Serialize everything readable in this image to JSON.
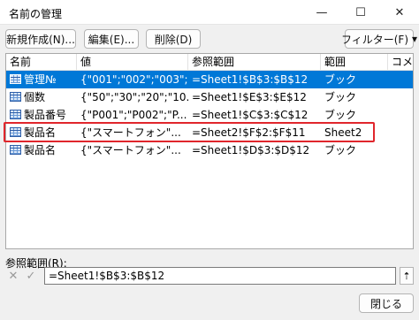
{
  "window": {
    "title": "名前の管理",
    "minimize_glyph": "—",
    "maximize_glyph": "☐",
    "close_glyph": "✕"
  },
  "toolbar": {
    "new_label": "新規作成(N)...",
    "edit_label": "編集(E)...",
    "delete_label": "削除(D)",
    "filter_label": "フィルター(F)",
    "filter_arrow": "▾"
  },
  "columns": [
    "名前",
    "値",
    "参照範囲",
    "範囲",
    "コメ"
  ],
  "rows": [
    {
      "name": "管理№",
      "value": "{\"001\";\"002\";\"003\";...",
      "ref": "=Sheet1!$B$3:$B$12",
      "scope": "ブック",
      "selected": true
    },
    {
      "name": "個数",
      "value": "{\"50\";\"30\";\"20\";\"10...",
      "ref": "=Sheet1!$E$3:$E$12",
      "scope": "ブック",
      "selected": false
    },
    {
      "name": "製品番号",
      "value": "{\"P001\";\"P002\";\"P...",
      "ref": "=Sheet1!$C$3:$C$12",
      "scope": "ブック",
      "selected": false
    },
    {
      "name": "製品名",
      "value": "{\"スマートフォン\"...",
      "ref": "=Sheet2!$F$2:$F$11",
      "scope": "Sheet2",
      "selected": false
    },
    {
      "name": "製品名",
      "value": "{\"スマートフォン\"...",
      "ref": "=Sheet1!$D$3:$D$12",
      "scope": "ブック",
      "selected": false
    }
  ],
  "reference": {
    "label": "参照範囲(R):",
    "value": "=Sheet1!$B$3:$B$12",
    "cancel_glyph": "✕",
    "confirm_glyph": "✓",
    "collapse_glyph": "⇡"
  },
  "footer": {
    "close_label": "閉じる"
  },
  "colors": {
    "selection": "#0078d7",
    "highlight_border": "#e0262c"
  }
}
